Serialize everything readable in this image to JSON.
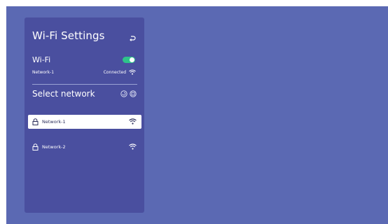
{
  "settings": {
    "title": "Wi-Fi Settings",
    "wifi_label": "Wi-Fi",
    "wifi_enabled": true,
    "current_network": "Network-1",
    "connection_status": "Connected",
    "select_label": "Select network",
    "networks": [
      {
        "name": "Network-1",
        "secured": true,
        "selected": true
      },
      {
        "name": "Network-2",
        "secured": true,
        "selected": false
      }
    ]
  },
  "icons": {
    "back": "back-arrow-icon",
    "toggle": "toggle-switch",
    "status_signal": "wifi-signal-icon",
    "refresh": "refresh-icon",
    "more": "more-icon",
    "lock": "lock-icon",
    "signal": "wifi-signal-icon"
  },
  "colors": {
    "screen_bg": "#5b69b3",
    "panel_bg": "#4a4f9f",
    "toggle_on": "#2ec38a",
    "selected_item_bg": "#ffffff",
    "text": "#ffffff"
  }
}
